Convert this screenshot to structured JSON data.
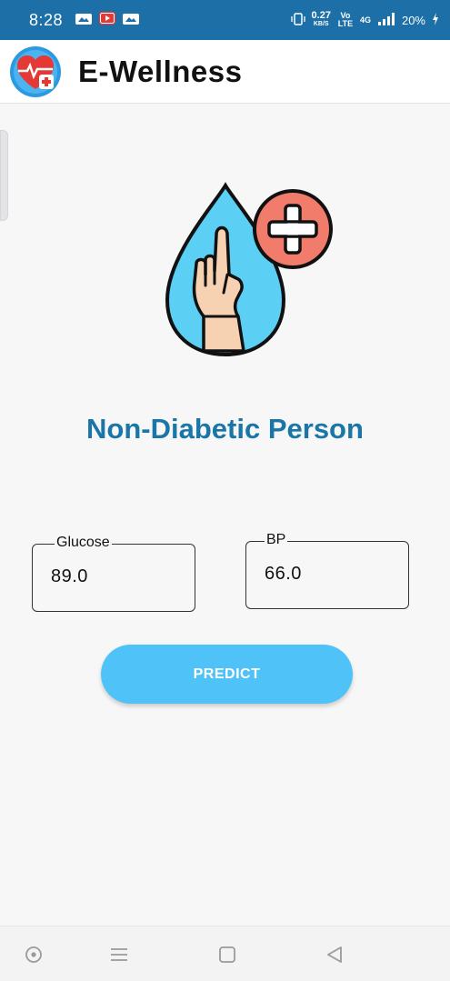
{
  "status_bar": {
    "time": "8:28",
    "net_speed_value": "0.27",
    "net_speed_unit": "KB/S",
    "volte": "Vo LTE",
    "network": "4G",
    "battery": "20%",
    "icons": [
      "notification-icon",
      "youtube-icon",
      "notification-icon",
      "vibrate-icon",
      "signal-icon",
      "battery-charging-icon"
    ]
  },
  "app_bar": {
    "title": "E-Wellness",
    "logo_icon": "heart-medical-icon"
  },
  "main": {
    "illustration_icon": "blood-drop-finger-plus-icon",
    "result": "Non-Diabetic Person",
    "glucose": {
      "label": "Glucose",
      "value": "89.0"
    },
    "bp": {
      "label": "BP",
      "value": "66.0"
    },
    "predict_label": "PREDICT"
  },
  "nav_bar": {
    "buttons": [
      "assistant-icon",
      "menu-icon",
      "home-icon",
      "back-icon"
    ]
  },
  "colors": {
    "status_bar": "#1d6fa8",
    "accent_text": "#1b76a8",
    "button": "#4fc3f7",
    "drop_fill": "#5ccff5",
    "plus_badge": "#f27c6b"
  }
}
